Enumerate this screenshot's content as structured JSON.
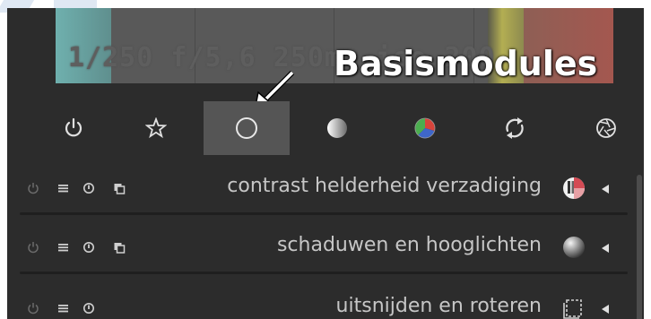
{
  "histogram": {
    "exif_text": "1/250 f/5,6 250mm iso 200",
    "colors": {
      "left": "#6aa5a3",
      "right": "#a85a55",
      "yellow": "#b5b050",
      "gray": "#585858"
    }
  },
  "callout": {
    "text": "Basismodules"
  },
  "tabs": [
    {
      "icon": "power-icon",
      "active": false
    },
    {
      "icon": "star-icon",
      "active": false
    },
    {
      "icon": "circle-outline-icon",
      "active": true
    },
    {
      "icon": "gradient-circle-icon",
      "active": false
    },
    {
      "icon": "color-wheel-icon",
      "active": false
    },
    {
      "icon": "refresh-icon",
      "active": false
    },
    {
      "icon": "aperture-icon",
      "active": false
    }
  ],
  "modules": [
    {
      "label": "contrast helderheid verzadiging",
      "icon": "contrast-ball-icon",
      "has_copy": true
    },
    {
      "label": "schaduwen en hooglichten",
      "icon": "sphere-icon",
      "has_copy": true
    },
    {
      "label": "uitsnijden en roteren",
      "icon": "crop-icon",
      "has_copy": false
    }
  ]
}
